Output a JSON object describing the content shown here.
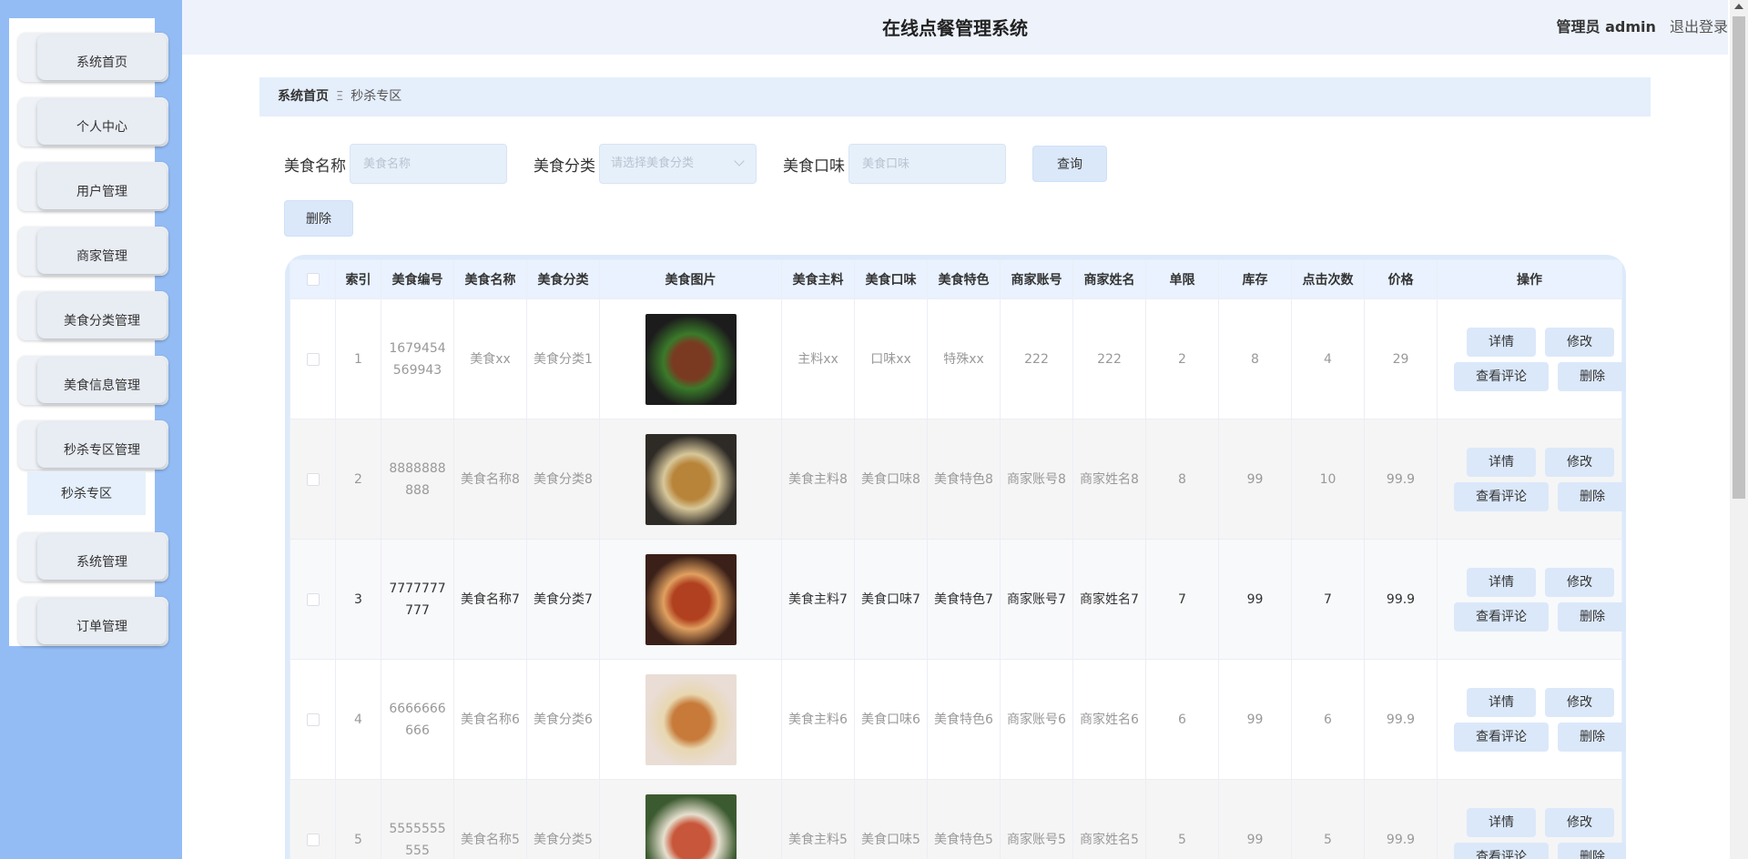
{
  "app": {
    "title": "在线点餐管理系统"
  },
  "user": {
    "label": "管理员 admin",
    "logout": "退出登录"
  },
  "sidebar": {
    "items": [
      {
        "label": "系统首页"
      },
      {
        "label": "个人中心"
      },
      {
        "label": "用户管理"
      },
      {
        "label": "商家管理"
      },
      {
        "label": "美食分类管理"
      },
      {
        "label": "美食信息管理"
      },
      {
        "label": "秒杀专区管理"
      },
      {
        "label": "系统管理"
      },
      {
        "label": "订单管理"
      }
    ],
    "submenu": {
      "label": "秒杀专区"
    }
  },
  "breadcrumb": {
    "home": "系统首页",
    "separator": "Ξ",
    "current": "秒杀专区"
  },
  "search": {
    "name_label": "美食名称",
    "name_placeholder": "美食名称",
    "category_label": "美食分类",
    "category_placeholder": "请选择美食分类",
    "taste_label": "美食口味",
    "taste_placeholder": "美食口味",
    "query_button": "查询",
    "delete_button": "删除"
  },
  "table": {
    "headers": [
      "",
      "索引",
      "美食编号",
      "美食名称",
      "美食分类",
      "美食图片",
      "美食主料",
      "美食口味",
      "美食特色",
      "商家账号",
      "商家姓名",
      "单限",
      "库存",
      "点击次数",
      "价格",
      "操作"
    ],
    "rows": [
      {
        "index": "1",
        "code": "1679454569943",
        "name": "美食xx",
        "category": "美食分类1",
        "main": "主料xx",
        "taste": "口味xx",
        "feature": "特殊xx",
        "account": "222",
        "merchant": "222",
        "limit": "2",
        "stock": "8",
        "clicks": "4",
        "price": "29"
      },
      {
        "index": "2",
        "code": "8888888888",
        "name": "美食名称8",
        "category": "美食分类8",
        "main": "美食主料8",
        "taste": "美食口味8",
        "feature": "美食特色8",
        "account": "商家账号8",
        "merchant": "商家姓名8",
        "limit": "8",
        "stock": "99",
        "clicks": "10",
        "price": "99.9"
      },
      {
        "index": "3",
        "code": "7777777777",
        "name": "美食名称7",
        "category": "美食分类7",
        "main": "美食主料7",
        "taste": "美食口味7",
        "feature": "美食特色7",
        "account": "商家账号7",
        "merchant": "商家姓名7",
        "limit": "7",
        "stock": "99",
        "clicks": "7",
        "price": "99.9"
      },
      {
        "index": "4",
        "code": "6666666666",
        "name": "美食名称6",
        "category": "美食分类6",
        "main": "美食主料6",
        "taste": "美食口味6",
        "feature": "美食特色6",
        "account": "商家账号6",
        "merchant": "商家姓名6",
        "limit": "6",
        "stock": "99",
        "clicks": "6",
        "price": "99.9"
      },
      {
        "index": "5",
        "code": "5555555555",
        "name": "美食名称5",
        "category": "美食分类5",
        "main": "美食主料5",
        "taste": "美食口味5",
        "feature": "美食特色5",
        "account": "商家账号5",
        "merchant": "商家姓名5",
        "limit": "5",
        "stock": "99",
        "clicks": "5",
        "price": "99.9"
      }
    ],
    "actions": {
      "detail": "详情",
      "edit": "修改",
      "comments": "查看评论",
      "delete": "删除"
    }
  },
  "colors": {
    "sidebar": "#93bcf5",
    "accent": "#dbe8fa",
    "header": "#eef3fb"
  }
}
